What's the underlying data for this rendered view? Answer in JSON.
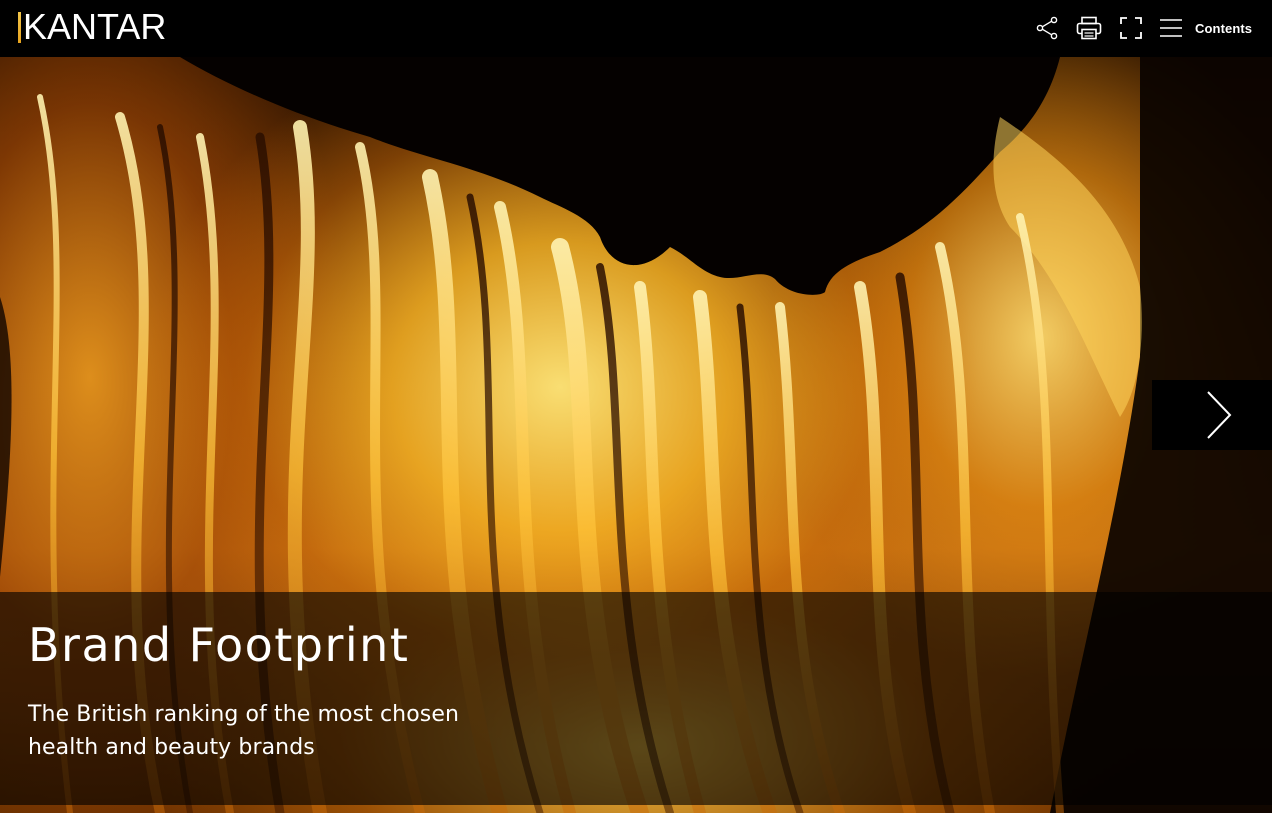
{
  "header": {
    "logo_text": "KANTAR",
    "logo_accent_color": "#F0B63A",
    "toolbar": {
      "share_icon": "share-icon",
      "print_icon": "print-icon",
      "fullscreen_icon": "fullscreen-icon",
      "menu_icon": "hamburger-menu-icon",
      "contents_label": "Contents"
    }
  },
  "hero": {
    "image_description_icon": "hero-photo",
    "title": "Brand Footprint",
    "subtitle": "The British ranking of the most chosen health and beauty brands",
    "next_icon": "chevron-right-icon"
  },
  "colors": {
    "background": "#000000",
    "text": "#FFFFFF",
    "caption_overlay": "rgba(0,0,0,0.62)"
  }
}
